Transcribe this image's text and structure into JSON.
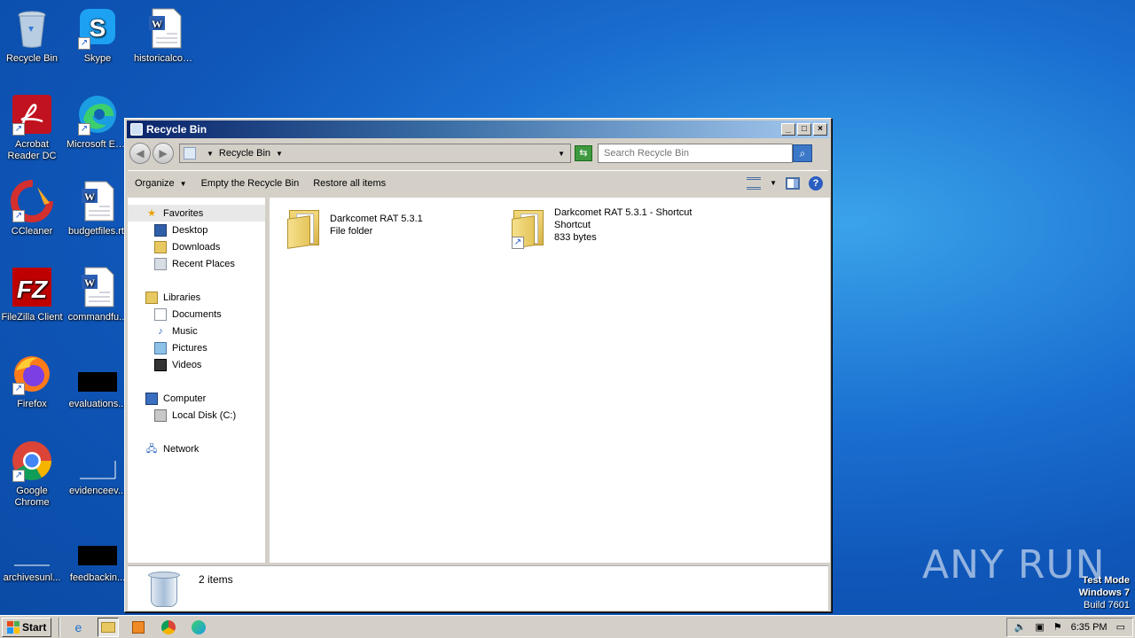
{
  "desktop": {
    "icons": [
      {
        "label": "Recycle Bin",
        "icon": "recycle-bin-icon"
      },
      {
        "label": "Skype",
        "icon": "skype-icon"
      },
      {
        "label": "historicalcop...",
        "icon": "word-doc-icon"
      },
      {
        "label": "Acrobat Reader DC",
        "icon": "acrobat-icon"
      },
      {
        "label": "Microsoft Edge",
        "icon": "edge-icon"
      },
      {
        "label": "CCleaner",
        "icon": "ccleaner-icon"
      },
      {
        "label": "budgetfiles.rtf",
        "icon": "word-doc-icon"
      },
      {
        "label": "FileZilla Client",
        "icon": "filezilla-icon"
      },
      {
        "label": "commandfu...",
        "icon": "word-doc-icon"
      },
      {
        "label": "Firefox",
        "icon": "firefox-icon"
      },
      {
        "label": "evaluations...",
        "icon": "black-file-icon"
      },
      {
        "label": "Google Chrome",
        "icon": "chrome-icon"
      },
      {
        "label": "evidenceev...",
        "icon": "blank-file-icon"
      },
      {
        "label": "archivesunl...",
        "icon": "blank-file-icon"
      },
      {
        "label": "feedbackin...",
        "icon": "black-file-icon"
      }
    ],
    "watermark": {
      "line1": "Test Mode",
      "line2": "Windows 7",
      "line3": "Build 7601"
    },
    "anyrun": "ANY RUN"
  },
  "window": {
    "title": "Recycle Bin",
    "address": "Recycle Bin",
    "search_placeholder": "Search Recycle Bin",
    "commands": {
      "organize": "Organize",
      "empty": "Empty the Recycle Bin",
      "restore": "Restore all items"
    },
    "nav": {
      "favorites": "Favorites",
      "desktop": "Desktop",
      "downloads": "Downloads",
      "recent": "Recent Places",
      "libraries": "Libraries",
      "documents": "Documents",
      "music": "Music",
      "pictures": "Pictures",
      "videos": "Videos",
      "computer": "Computer",
      "localdisk": "Local Disk (C:)",
      "network": "Network"
    },
    "items": [
      {
        "name": "Darkcomet RAT 5.3.1",
        "type": "File folder",
        "size": ""
      },
      {
        "name": "Darkcomet RAT 5.3.1 - Shortcut",
        "type": "Shortcut",
        "size": "833 bytes"
      }
    ],
    "status": "2 items"
  },
  "taskbar": {
    "start": "Start",
    "clock": "6:35 PM"
  }
}
